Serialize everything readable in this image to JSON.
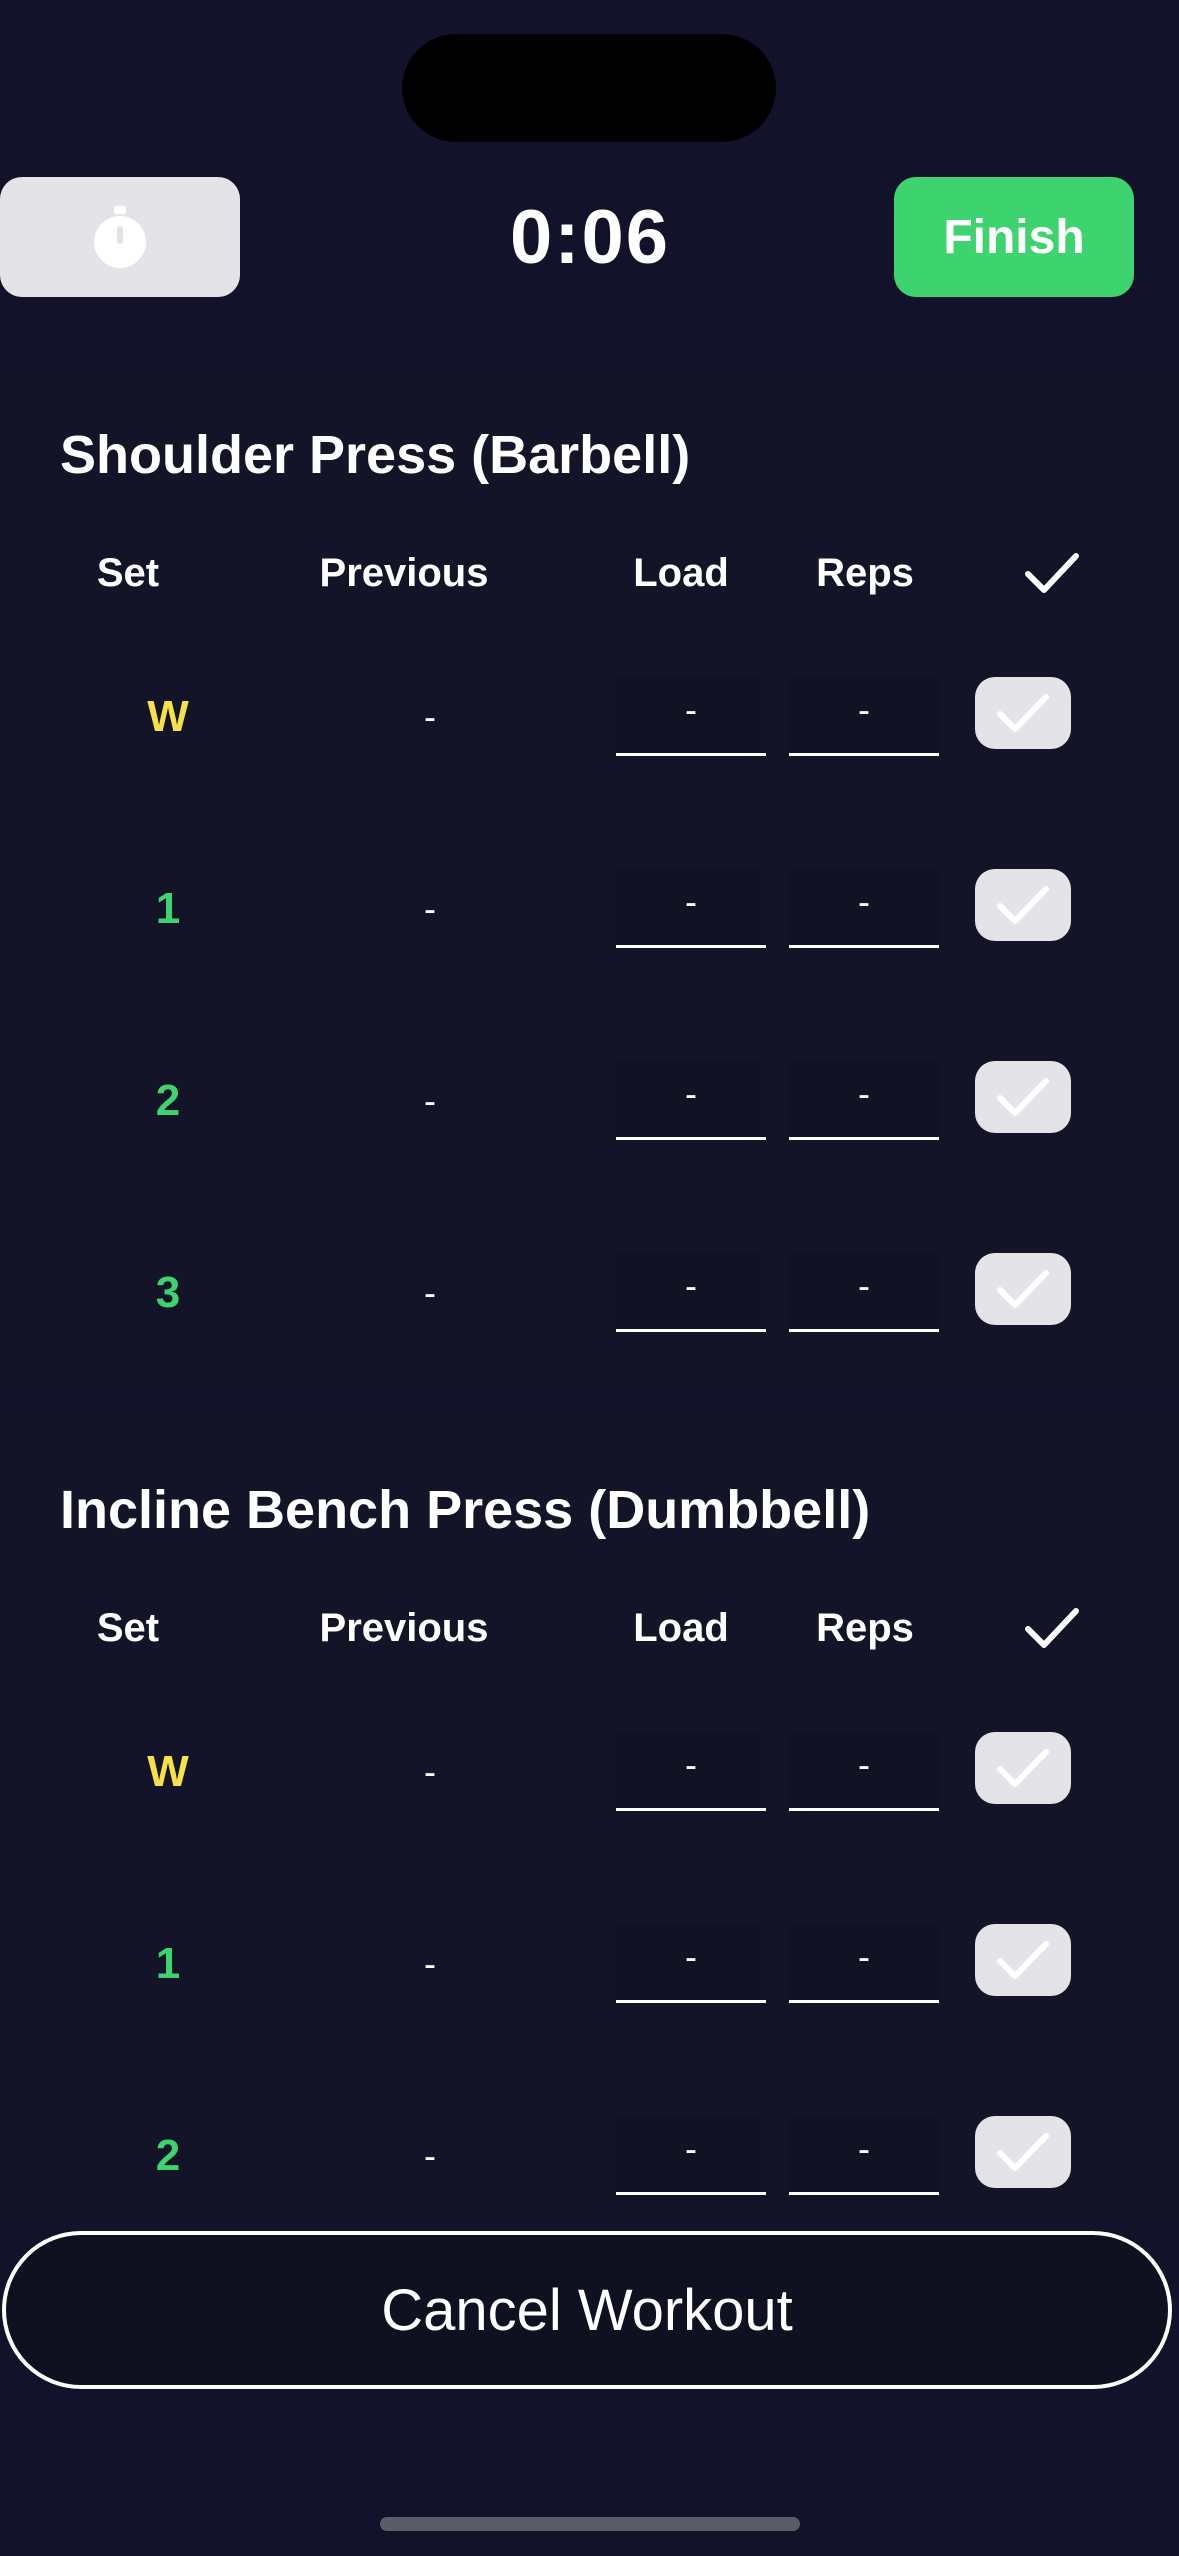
{
  "header": {
    "elapsed_time": "0:06",
    "finish_label": "Finish",
    "timer_icon": "stopwatch-icon"
  },
  "columns": {
    "set": "Set",
    "previous": "Previous",
    "load": "Load",
    "reps": "Reps",
    "done_icon": "checkmark-icon"
  },
  "exercises": [
    {
      "title": "Shoulder Press (Barbell)",
      "sets": [
        {
          "label": "W",
          "type": "warmup",
          "previous": "-",
          "load": "-",
          "reps": "-"
        },
        {
          "label": "1",
          "type": "working",
          "previous": "-",
          "load": "-",
          "reps": "-"
        },
        {
          "label": "2",
          "type": "working",
          "previous": "-",
          "load": "-",
          "reps": "-"
        },
        {
          "label": "3",
          "type": "working",
          "previous": "-",
          "load": "-",
          "reps": "-"
        }
      ]
    },
    {
      "title": "Incline Bench Press (Dumbbell)",
      "sets": [
        {
          "label": "W",
          "type": "warmup",
          "previous": "-",
          "load": "-",
          "reps": "-"
        },
        {
          "label": "1",
          "type": "working",
          "previous": "-",
          "load": "-",
          "reps": "-"
        },
        {
          "label": "2",
          "type": "working",
          "previous": "-",
          "load": "-",
          "reps": "-"
        }
      ]
    }
  ],
  "footer": {
    "cancel_label": "Cancel Workout"
  },
  "colors": {
    "background": "#12132a",
    "accent_green": "#3dd46f",
    "warmup_yellow": "#f5e24a",
    "button_gray": "#e3e3e8"
  }
}
